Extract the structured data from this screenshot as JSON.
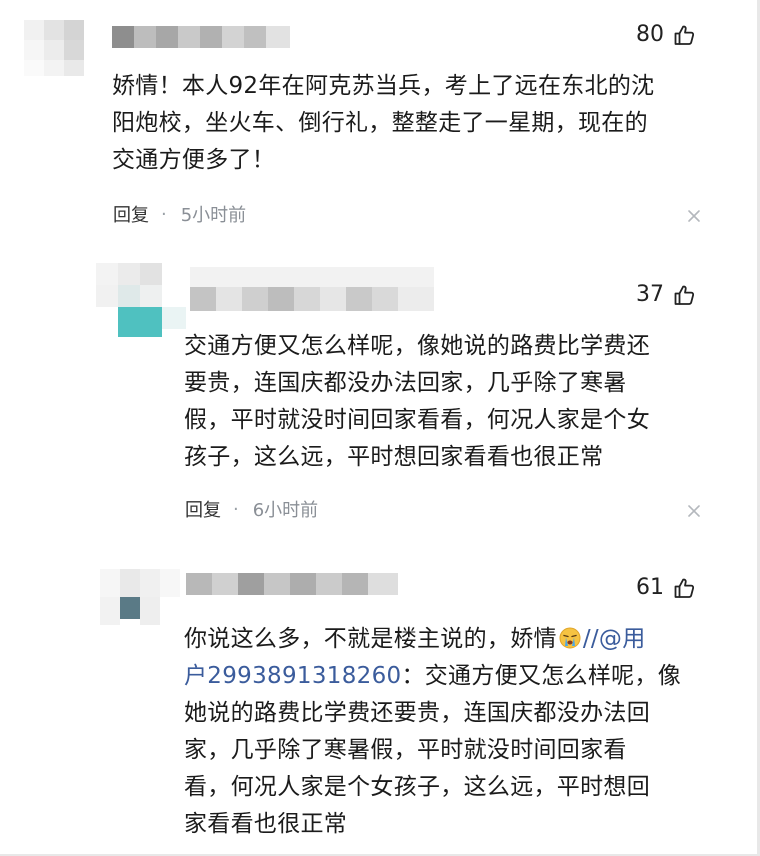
{
  "comments": [
    {
      "likes": "80",
      "lines": [
        "娇情！本人92年在阿克苏当兵，考上了远在东北的沈",
        "阳炮校，坐火车、倒行礼，整整走了一星期，现在的",
        "交通方便多了！"
      ],
      "reply_label": "回复",
      "separator": "·",
      "time": "5小时前"
    },
    {
      "likes": "37",
      "lines": [
        "交通方便又怎么样呢，像她说的路费比学费还",
        "要贵，连国庆都没办法回家，几乎除了寒暑",
        "假，平时就没时间回家看看，何况人家是个女",
        "孩子，这么远，平时想回家看看也很正常"
      ],
      "reply_label": "回复",
      "separator": "·",
      "time": "6小时前"
    },
    {
      "likes": "61",
      "line1_before": "你说这么多，不就是楼主说的，娇情",
      "line1_mention": "//@用",
      "line2_mention": "户2993891318260",
      "line2_rest": "：交通方便又怎么样呢，像",
      "lines_rest": [
        "她说的路费比学费还要贵，连国庆都没办法回",
        "家，几乎除了寒暑假，平时就没时间回家看",
        "看，何况人家是个女孩子，这么远，平时想回",
        "家看看也很正常"
      ]
    }
  ],
  "icons": {
    "like": "thumbs-up-icon",
    "close": "close-icon",
    "emoji": "crying-emoji-icon",
    "avatar": "blurred-avatar"
  },
  "colors": {
    "text": "#1b1b1b",
    "mention": "#3b5c9c",
    "time": "#8a8f96",
    "avatar_teal": "#4fc1c0"
  }
}
